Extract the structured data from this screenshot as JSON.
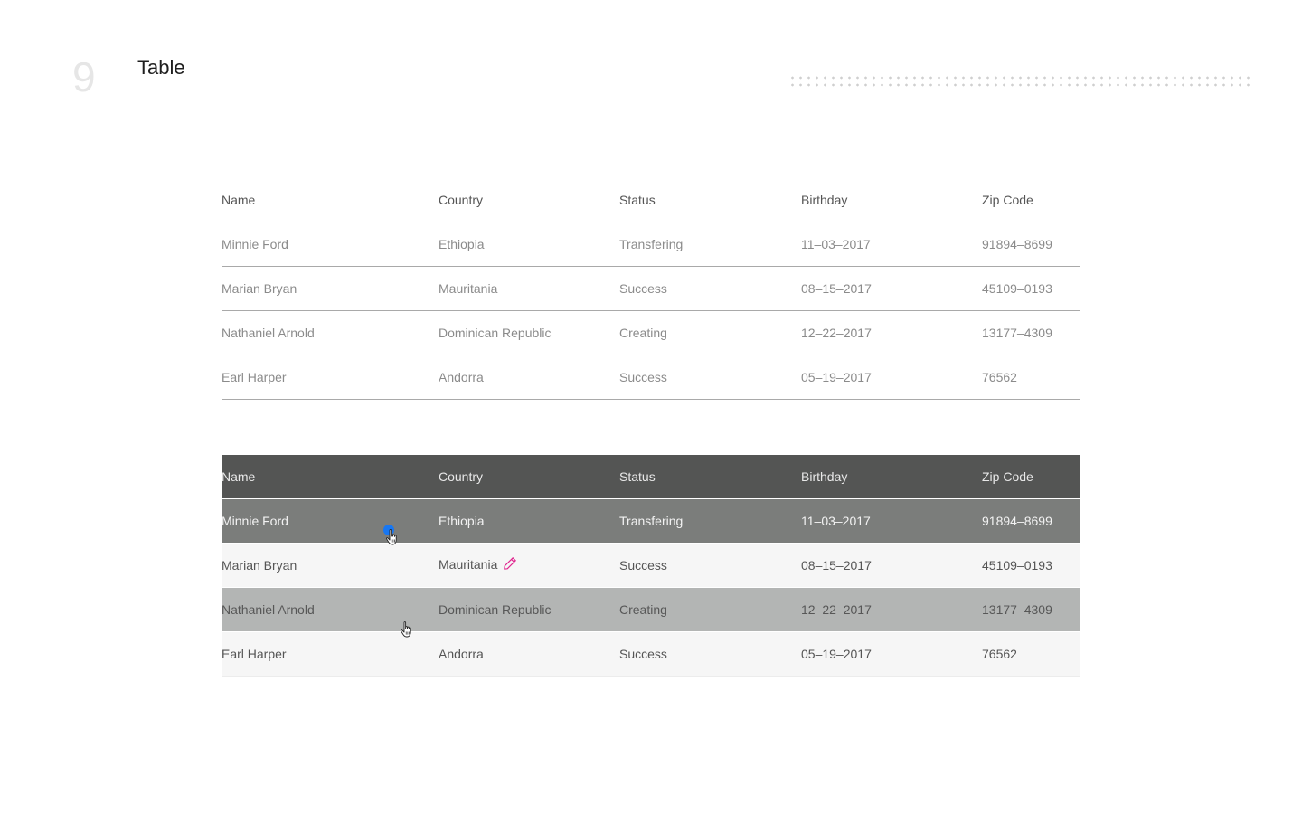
{
  "header": {
    "section_number": "9",
    "title": "Table"
  },
  "columns": [
    "Name",
    "Country",
    "Status",
    "Birthday",
    "Zip Code"
  ],
  "table_plain": {
    "rows": [
      {
        "name": "Minnie Ford",
        "country": "Ethiopia",
        "status": "Transfering",
        "birthday": "11–03–2017",
        "zip": "91894–8699"
      },
      {
        "name": "Marian Bryan",
        "country": "Mauritania",
        "status": "Success",
        "birthday": "08–15–2017",
        "zip": "45109–0193"
      },
      {
        "name": "Nathaniel Arnold",
        "country": "Dominican Republic",
        "status": "Creating",
        "birthday": "12–22–2017",
        "zip": "13177–4309"
      },
      {
        "name": "Earl Harper",
        "country": "Andorra",
        "status": "Success",
        "birthday": "05–19–2017",
        "zip": "76562"
      }
    ]
  },
  "table_styled": {
    "rows": [
      {
        "name": "Minnie Ford",
        "country": "Ethiopia",
        "status": "Transfering",
        "birthday": "11–03–2017",
        "zip": "91894–8699",
        "state": "selected"
      },
      {
        "name": "Marian Bryan",
        "country": "Mauritania",
        "status": "Success",
        "birthday": "08–15–2017",
        "zip": "45109–0193",
        "state": "editing"
      },
      {
        "name": "Nathaniel Arnold",
        "country": "Dominican Republic",
        "status": "Creating",
        "birthday": "12–22–2017",
        "zip": "13177–4309",
        "state": "hover"
      },
      {
        "name": "Earl Harper",
        "country": "Andorra",
        "status": "Success",
        "birthday": "05–19–2017",
        "zip": "76562",
        "state": "default"
      }
    ]
  },
  "icons": {
    "edit": "pencil-icon",
    "cursor": "hand-pointer-icon"
  },
  "colors": {
    "header_dark": "#545554",
    "row_selected": "#7b7d7b",
    "row_hover": "#b3b5b4",
    "row_light": "#f6f6f6",
    "edit_icon": "#e0268f",
    "click_indicator": "#1877f2"
  }
}
